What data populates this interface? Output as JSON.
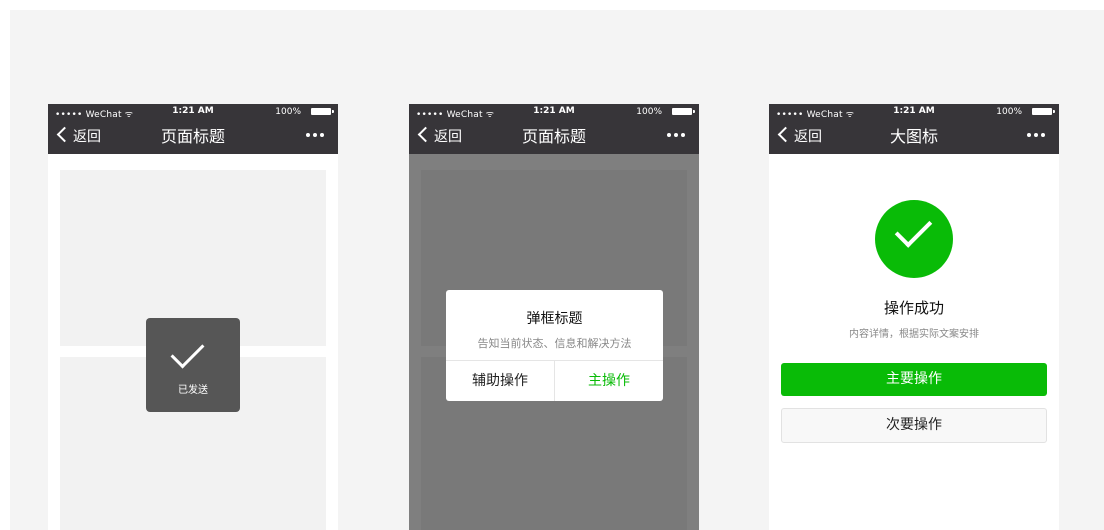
{
  "statusbar": {
    "carrier": "••••• WeChat ᯤ",
    "time": "1:21 AM",
    "battery": "100%"
  },
  "phone1": {
    "nav": {
      "back_label": "返回",
      "title": "页面标题",
      "more_icon": "more-dots-icon"
    },
    "toast": {
      "icon": "check-icon",
      "text": "已发送"
    }
  },
  "phone2": {
    "nav": {
      "back_label": "返回",
      "title": "页面标题",
      "more_icon": "more-dots-icon"
    },
    "dialog": {
      "title": "弹框标题",
      "description": "告知当前状态、信息和解决方法",
      "secondary_label": "辅助操作",
      "primary_label": "主操作"
    }
  },
  "phone3": {
    "nav": {
      "back_label": "返回",
      "title": "大图标",
      "more_icon": "more-dots-icon"
    },
    "result": {
      "icon": "success-check-icon",
      "title": "操作成功",
      "description": "内容详情，根据实际文案安排",
      "primary_label": "主要操作",
      "secondary_label": "次要操作"
    }
  },
  "colors": {
    "navbar_bg": "#373539",
    "brand_green": "#09bb07",
    "toast_bg": "#565656",
    "stage_bg": "#f4f4f4"
  }
}
